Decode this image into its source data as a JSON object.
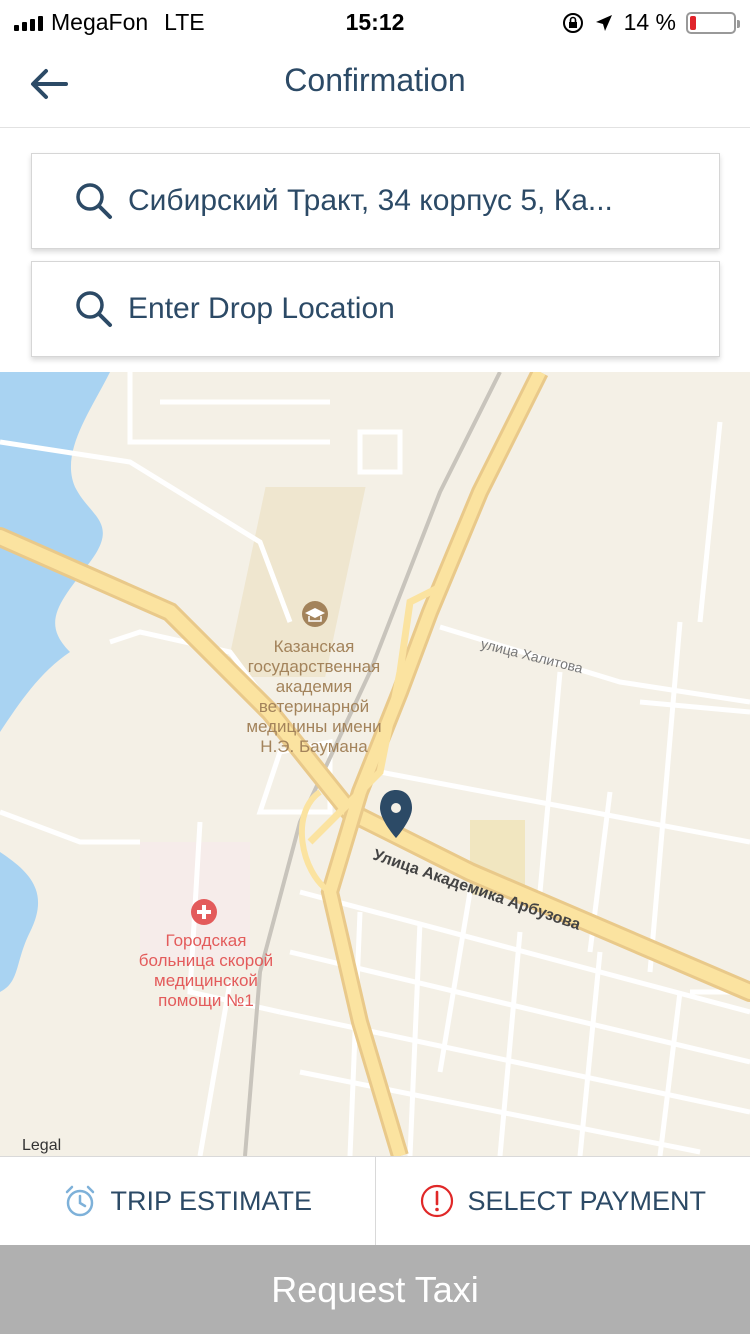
{
  "status_bar": {
    "carrier": "MegaFon",
    "network": "LTE",
    "time": "15:12",
    "battery": "14 %"
  },
  "header": {
    "title": "Confirmation"
  },
  "pickup": {
    "value": "Сибирский Тракт, 34 корпус 5, Ка..."
  },
  "drop": {
    "placeholder": "Enter Drop Location"
  },
  "map": {
    "labels": {
      "academy": [
        "Казанская",
        "государственная",
        "академия",
        "ветеринарной",
        "медицины имени",
        "Н.Э. Баумана"
      ],
      "hospital": [
        "Городская",
        "больница скорой",
        "медицинской",
        "помощи №1"
      ],
      "street1": "Улица Академика Арбузова",
      "street2": "улица Халитова"
    },
    "legal": "Legal",
    "colors": {
      "water": "#a9d3f2",
      "road_major": "#fbe3a0",
      "road_minor": "#ffffff",
      "pin": "#2c4a66",
      "poi_brown": "#a3835b",
      "poi_red": "#e35b5b"
    }
  },
  "actions": {
    "trip_estimate": "TRIP ESTIMATE",
    "select_payment": "SELECT PAYMENT"
  },
  "request_button": "Request Taxi"
}
